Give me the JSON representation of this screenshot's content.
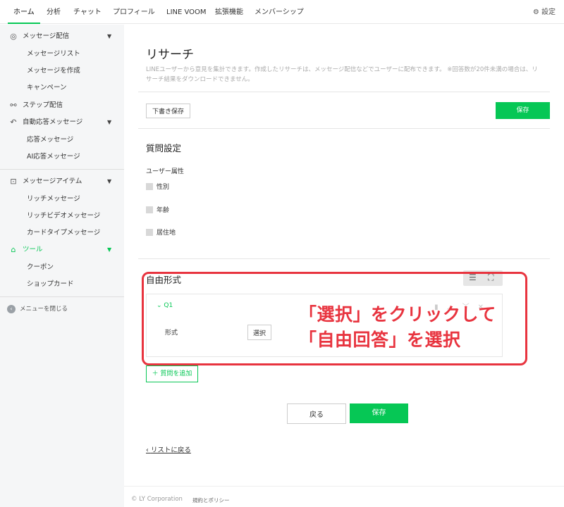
{
  "nav": {
    "tabs": [
      "ホーム",
      "分析",
      "チャット",
      "プロフィール",
      "LINE VOOM",
      "拡張機能",
      "メンバーシップ"
    ],
    "settings": "設定"
  },
  "sidebar": {
    "items": [
      {
        "label": "メッセージ配信",
        "icon": "broadcast-icon"
      },
      {
        "label": "メッセージリスト"
      },
      {
        "label": "メッセージを作成"
      },
      {
        "label": "キャンペーン"
      },
      {
        "label": "ステップ配信",
        "icon": "step-icon"
      },
      {
        "label": "自動応答メッセージ",
        "icon": "reply-icon"
      },
      {
        "label": "応答メッセージ"
      },
      {
        "label": "AI応答メッセージ"
      },
      {
        "label": "メッセージアイテム",
        "icon": "message-item-icon"
      },
      {
        "label": "リッチメッセージ"
      },
      {
        "label": "リッチビデオメッセージ"
      },
      {
        "label": "カードタイプメッセージ"
      },
      {
        "label": "ツール",
        "icon": "store-icon"
      },
      {
        "label": "クーポン"
      },
      {
        "label": "ショップカード"
      }
    ],
    "close_label": "メニューを閉じる"
  },
  "page": {
    "title": "リサーチ",
    "description": "LINEユーザーから意見を集計できます。作成したリサーチは、メッセージ配信などでユーザーに配布できます。 ※回答数が20件未満の場合は、リサーチ結果をダウンロードできません。",
    "draft_save": "下書き保存",
    "save": "保存"
  },
  "question_settings": {
    "title": "質問設定",
    "attr_label": "ユーザー属性",
    "attrs": [
      "性別",
      "年齢",
      "居住地"
    ]
  },
  "free_form": {
    "title": "自由形式",
    "q_label": "Q1",
    "form_label": "形式",
    "select_button": "選択"
  },
  "annotation": {
    "line1": "「選択」をクリックして",
    "line2": "「自由回答」を選択"
  },
  "add_question": "＋ 質問を追加",
  "bottom": {
    "back": "戻る",
    "save": "保存",
    "back_to_list": "リストに戻る"
  },
  "footer": {
    "copyright": "© LY Corporation",
    "policy": "規約とポリシー"
  },
  "colors": {
    "accent": "#06c755",
    "annotation": "#e8343f"
  }
}
